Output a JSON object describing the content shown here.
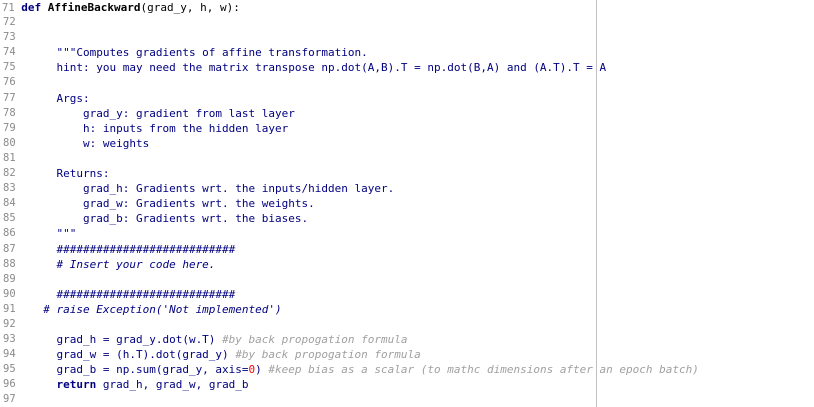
{
  "editor": {
    "line_numbers": [
      "72",
      "73",
      "74",
      "75",
      "76",
      "77",
      "78",
      "79",
      "80",
      "81",
      "82",
      "83",
      "84",
      "85",
      "86",
      "87",
      "88",
      "89",
      "90",
      "91",
      "92",
      "93",
      "94",
      "95",
      "96",
      "97"
    ],
    "first_line": {
      "number": "71",
      "keyword": "def",
      "func_name": "AffineBackward",
      "rest": "(grad_y, h, w):"
    },
    "lines": [
      "",
      "",
      "    \"\"\"Computes gradients of affine transformation.",
      "    hint: you may need the matrix transpose np.dot(A,B).T = np.dot(B,A) and (A.T).T = A",
      "",
      "    Args:",
      "        grad_y: gradient from last layer",
      "        h: inputs from the hidden layer",
      "        w: weights",
      "",
      "    Returns:",
      "        grad_h: Gradients wrt. the inputs/hidden layer.",
      "        grad_w: Gradients wrt. the weights.",
      "        grad_b: Gradients wrt. the biases.",
      "    \"\"\"",
      "    ###########################",
      "    # Insert your code here.",
      "",
      "    ###########################",
      "  # raise Exception('Not implemented')",
      "",
      "    grad_h = grad_y.dot(w.T) #by back propogation formula",
      "    grad_w = (h.T).dot(grad_y) #by back propogation formula",
      "    grad_b = np.sum(grad_y, axis=0) #keep bias as a scalar (to mathc dimensions after an epoch batch)",
      "    return grad_h, grad_w, grad_b",
      ""
    ],
    "code": {
      "l93": {
        "code": "    grad_h = grad_y.dot(w.T) ",
        "comment": "#by back propogation formula"
      },
      "l94": {
        "code": "    grad_w = (h.T).dot(grad_y) ",
        "comment": "#by back propogation formula"
      },
      "l95": {
        "code_a": "    grad_b = np.sum(grad_y, axis=",
        "num": "0",
        "code_b": ") ",
        "comment": "#keep bias as a scalar (to mathc dimensions after an epoch batch)"
      },
      "l96": {
        "kw": "    return",
        "rest": " grad_h, grad_w, grad_b"
      }
    }
  }
}
